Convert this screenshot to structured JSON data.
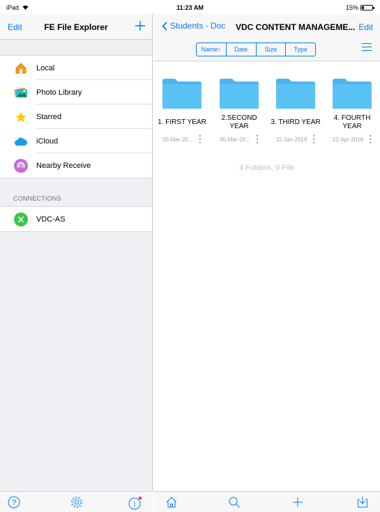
{
  "status": {
    "device": "iPad",
    "time": "11:23 AM",
    "battery": "15%"
  },
  "sidebar": {
    "edit_label": "Edit",
    "title": "FE File Explorer",
    "items": [
      {
        "label": "Local",
        "icon": "house-icon"
      },
      {
        "label": "Photo Library",
        "icon": "photo-library-icon"
      },
      {
        "label": "Starred",
        "icon": "star-icon"
      },
      {
        "label": "iCloud",
        "icon": "cloud-icon"
      },
      {
        "label": "Nearby Receive",
        "icon": "nearby-receive-icon"
      }
    ],
    "connections_header": "CONNECTIONS",
    "connections": [
      {
        "label": "VDC-AS",
        "icon": "connection-x-icon"
      }
    ]
  },
  "main": {
    "back_label": "Students - Doc",
    "title": "VDC CONTENT MANAGEME...",
    "edit_label": "Edit",
    "sort": [
      "Name↑",
      "Date",
      "Size",
      "Type"
    ],
    "folders": [
      {
        "name": "1. FIRST YEAR",
        "date": "05-Mar-20..."
      },
      {
        "name": "2.SECOND YEAR",
        "date": "05-Mar-20..."
      },
      {
        "name": "3. THIRD YEAR",
        "date": "11-Jan-2019"
      },
      {
        "name": "4. FOURTH YEAR",
        "date": "21-Apr-2018"
      }
    ],
    "summary": "4 Folders, 0 File"
  },
  "colors": {
    "accent": "#007aff",
    "folder": "#5ac8fa"
  }
}
